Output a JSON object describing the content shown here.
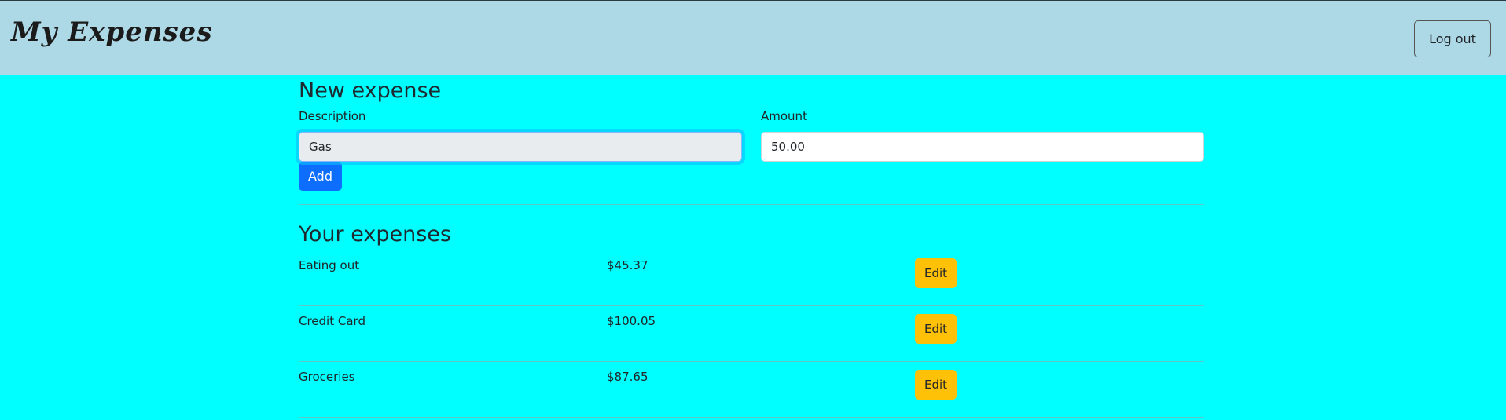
{
  "header": {
    "brand": "My Expenses",
    "logout_label": "Log out"
  },
  "new_expense": {
    "title": "New expense",
    "description_label": "Description",
    "description_value": "Gas",
    "amount_label": "Amount",
    "amount_value": "50.00",
    "add_label": "Add"
  },
  "expenses": {
    "title": "Your expenses",
    "edit_label": "Edit",
    "items": [
      {
        "description": "Eating out",
        "amount": "$45.37"
      },
      {
        "description": "Credit Card",
        "amount": "$100.05"
      },
      {
        "description": "Groceries",
        "amount": "$87.65"
      }
    ]
  },
  "colors": {
    "page_bg": "#00ffff",
    "navbar_bg": "#add8e6",
    "add_button": "#0d6efd",
    "edit_button": "#ffc107"
  }
}
